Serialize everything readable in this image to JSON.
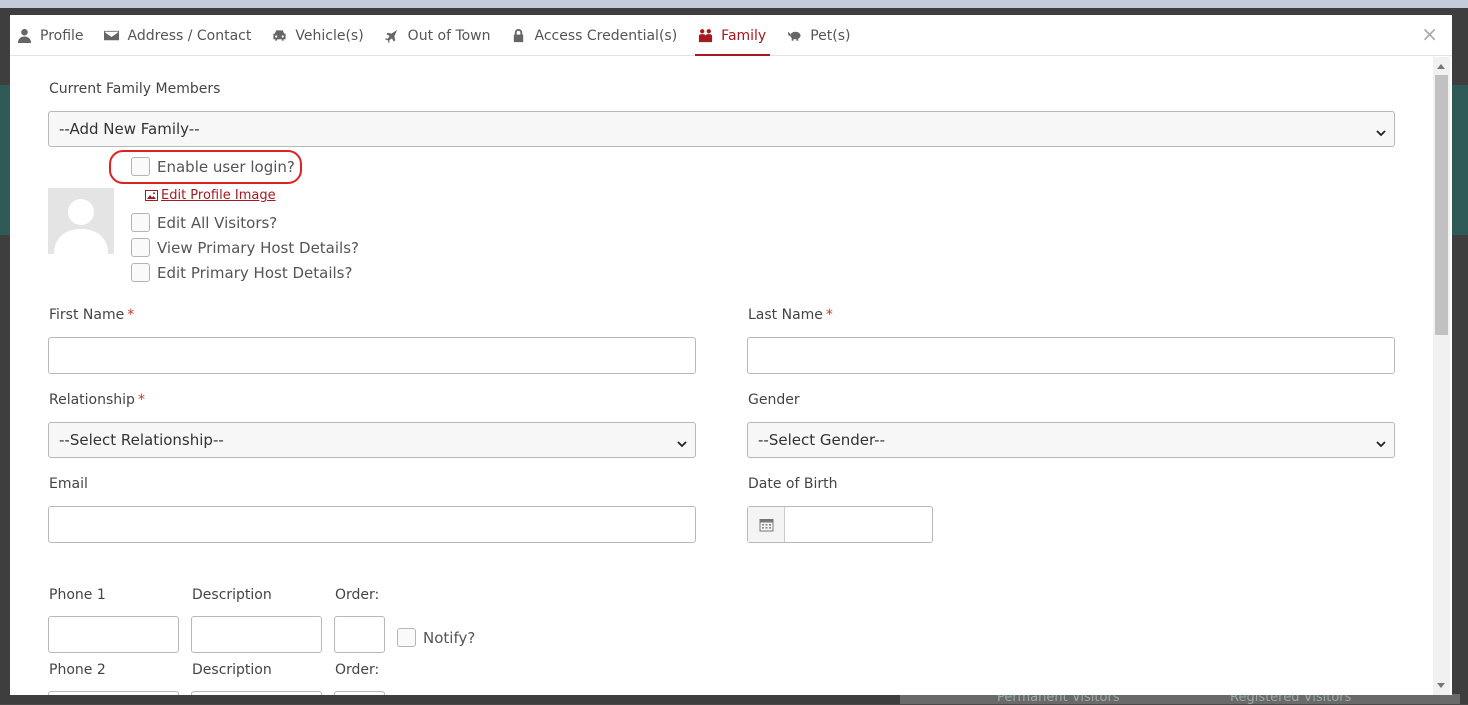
{
  "tabs": [
    {
      "label": "Profile",
      "icon": "user-icon"
    },
    {
      "label": "Address / Contact",
      "icon": "envelope-icon"
    },
    {
      "label": "Vehicle(s)",
      "icon": "car-icon"
    },
    {
      "label": "Out of Town",
      "icon": "plane-icon"
    },
    {
      "label": "Access Credential(s)",
      "icon": "lock-icon"
    },
    {
      "label": "Family",
      "icon": "family-icon",
      "active": true
    },
    {
      "label": "Pet(s)",
      "icon": "pet-icon"
    }
  ],
  "close_label": "×",
  "form": {
    "family_members_label": "Current Family Members",
    "family_members_value": "--Add New Family--",
    "enable_login": "Enable user login?",
    "edit_profile_image": "Edit Profile Image",
    "edit_all_visitors": "Edit All Visitors?",
    "view_primary_host": "View Primary Host Details?",
    "edit_primary_host": "Edit Primary Host Details?",
    "first_name": "First Name",
    "last_name": "Last Name",
    "relationship": "Relationship",
    "relationship_value": "--Select Relationship--",
    "gender": "Gender",
    "gender_value": "--Select Gender--",
    "email": "Email",
    "dob": "Date of Birth",
    "required_mark": "*",
    "phone1": "Phone 1",
    "phone2": "Phone 2",
    "description": "Description",
    "order": "Order:",
    "notify": "Notify?"
  },
  "background": {
    "permanent_visitors": "Permanent Visitors",
    "registered_visitors": "Registered Visitors"
  },
  "colors": {
    "accent": "#a51a20",
    "highlight": "#dd2222"
  }
}
